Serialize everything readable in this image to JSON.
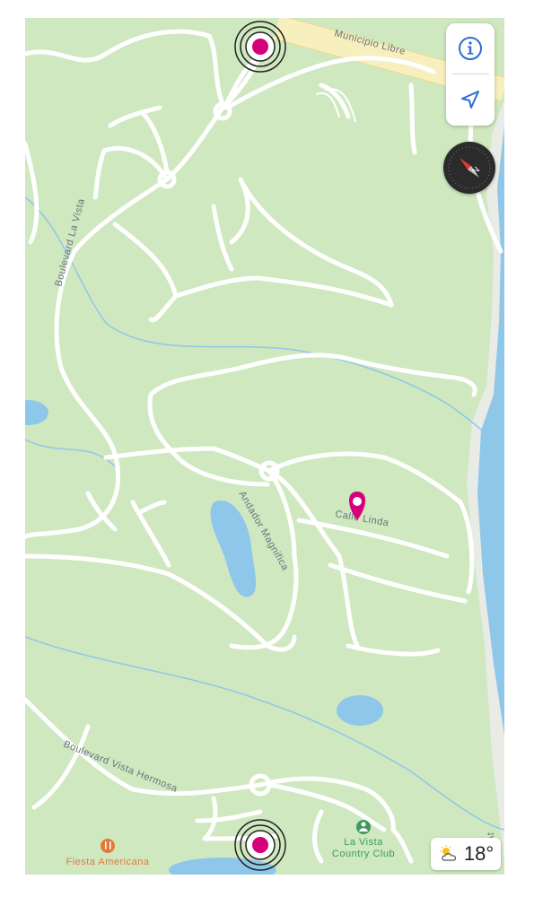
{
  "map": {
    "roads": {
      "top_highway": "Municipio Libre",
      "left_boulevard": "Boulevard La Vista",
      "middle_path": "Andador Magnifica",
      "street_pinned": "Calle Linda",
      "bottom_boulevard": "Boulevard Vista Hermosa",
      "river": "Rio At"
    },
    "pois": {
      "restaurant": "Fiesta Americana",
      "club_line1": "La Vista",
      "club_line2": "Country Club"
    },
    "pin_color": "#d6007a",
    "restaurant_color": "#e07a3c",
    "club_color": "#3c9a5f"
  },
  "controls": {
    "info_icon": "info-icon",
    "location_icon": "location-arrow-icon",
    "compass_label": "N"
  },
  "weather": {
    "icon": "partly-cloudy-icon",
    "temperature": "18°"
  }
}
